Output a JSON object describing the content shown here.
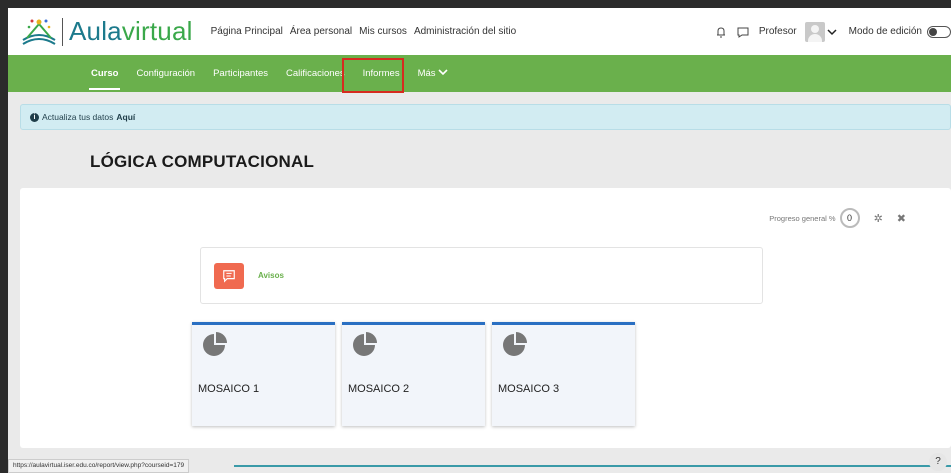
{
  "brand": {
    "text_main": "Aula",
    "text_accent": "virtual"
  },
  "nav": {
    "items": [
      "Página Principal",
      "Área personal",
      "Mis cursos",
      "Administración del sitio"
    ]
  },
  "user": {
    "role_label": "Profesor",
    "edit_mode_label": "Modo de edición"
  },
  "subnav": {
    "items": [
      {
        "label": "Curso"
      },
      {
        "label": "Configuración"
      },
      {
        "label": "Participantes"
      },
      {
        "label": "Calificaciones"
      },
      {
        "label": "Informes"
      },
      {
        "label": "Más"
      }
    ]
  },
  "alert": {
    "text": "Actualiza tus datos",
    "link": "Aquí"
  },
  "course": {
    "title": "LÓGICA COMPUTACIONAL"
  },
  "progress": {
    "label": "Progreso general %",
    "value": "0"
  },
  "announcements": {
    "label": "Avisos"
  },
  "tiles": [
    {
      "label": "MOSAICO 1"
    },
    {
      "label": "MOSAICO 2"
    },
    {
      "label": "MOSAICO 3"
    }
  ],
  "status_bar": {
    "url": "https://aulavirtual.iser.edu.co/report/view.php?courseid=179"
  },
  "help": {
    "label": "?"
  },
  "colors": {
    "green_nav": "#6ab04c",
    "teal_logo": "#1c7a8c",
    "avisos_icon": "#f06a50",
    "tile_border": "#2a6fc2",
    "highlight": "#d62b1f"
  }
}
